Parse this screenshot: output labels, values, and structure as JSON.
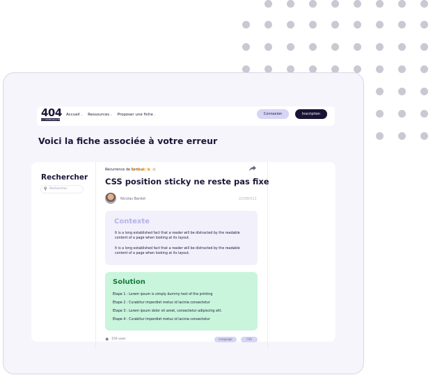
{
  "logo": {
    "number": "404",
    "subtitle": "LA COMMUNAUTÉ"
  },
  "nav": {
    "items": [
      "Accueil",
      "Ressources",
      "Proposer une fiche"
    ],
    "login": "Connexion",
    "signup": "Inscription"
  },
  "page_title": "Voici la fiche associée à votre erreur",
  "sidebar": {
    "title": "Rechercher",
    "search_placeholder": "Rechercher"
  },
  "article": {
    "recurrence_label": "Récurrence de l'erreur :",
    "rating": 4,
    "rating_max": 5,
    "title": "CSS position sticky ne reste pas fixe",
    "author": "Nicolas Bardot",
    "date": "22/08/022",
    "context": {
      "title": "Contexte",
      "paragraphs": [
        "It is a long established fact that a reader will be distracted by the readable content of a page when looking at its layout.",
        "It is a long established fact that a reader will be distracted by the readable content of a page when looking at its layout."
      ]
    },
    "solution": {
      "title": "Solution",
      "steps": [
        "Etape 1 : Lorem ipsum is simply dummy text of the printing",
        "Etape 2 : Curabitur imperdiet metus id lacinia consectetur",
        "Etape 3 : Lorem ipsum dolor sit amet, consectetur adipiscing elit.",
        "Etape 4 : Curabitur imperdiet metus id lacinia consectetur"
      ]
    },
    "views": "150 vues",
    "tags": [
      "Language",
      "CSS"
    ]
  },
  "colors": {
    "accent_dark": "#1a1336",
    "accent_light": "#d6d5f5",
    "solution_bg": "#c9f5dc",
    "solution_title": "#147a3b",
    "star": "#f5a524"
  },
  "icons": [
    "search-icon",
    "share-icon",
    "star-icon",
    "eye-icon"
  ]
}
